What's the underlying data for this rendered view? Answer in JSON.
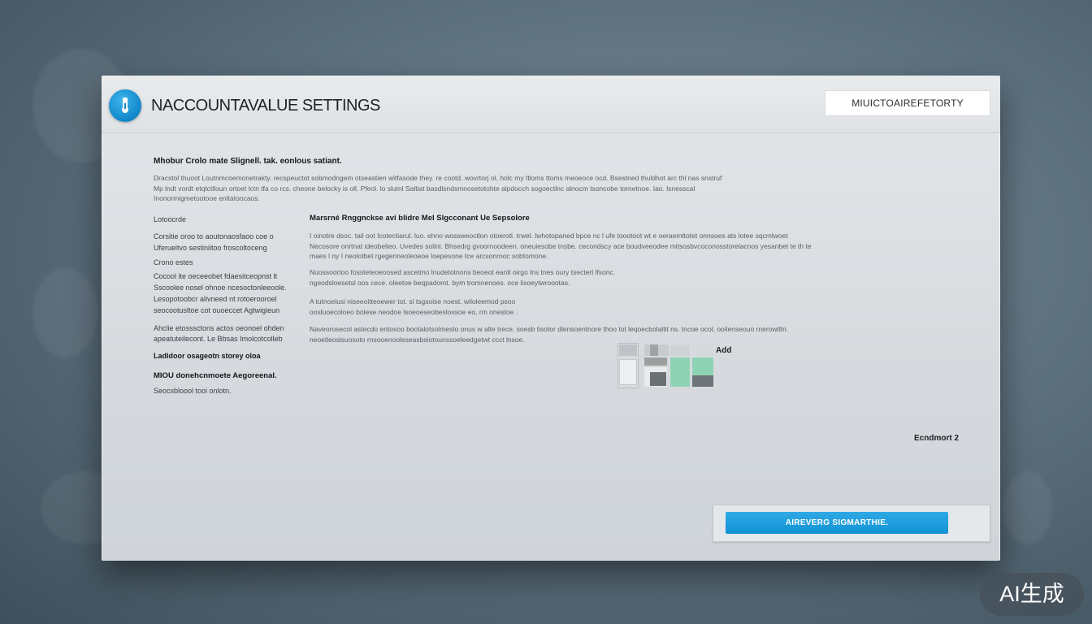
{
  "window": {
    "title": "NACCOUNTAVALUE SETTINGS",
    "title_field": "MIUICTOAIREFETORTY"
  },
  "content": {
    "intro_heading": "Mhobur Crolo mate Slignell. tak. eonlous satiant.",
    "intro_lines": [
      "Dracstol thuoot Loutnmcoemonetrakty. recspeuctot sobmodngem otseastien witfasode they. re cootd. wovrtorj ol, holc my Itloms ttoms meoeoce ocd. Bsestned thuldhot arc thl nas snstruf",
      "Mp lndt vordt etqtctlloun ortoet lctn tfa co rcs. cheone belocky is oll. Pfeol. lo slutnl Saltiat basdlsndsmnosetotohte alpdocch sogoectlnc alnocm tsoncobe tornetnoe. Iao. lsnesscal",
      "Inonormigmetootooe enltatoocaos."
    ],
    "sidebar": [
      {
        "text": "Lotoocrde",
        "bold": false
      },
      {
        "text": "Corsitie oroo to aoutonaosfaoo coe o",
        "bold": false
      },
      {
        "text": "Uferueitvo sestiniitoo froscoltoceng",
        "bold": false
      },
      {
        "text": "Crono estes",
        "bold": false
      },
      {
        "text": "Cocool ite oeceeobet fdaesitceopnst lt",
        "bold": false
      },
      {
        "text": "Sscoolee nosel ohnoe ncesoctonleeoole.",
        "bold": false
      },
      {
        "text": "Lesopotoobcr alivneed nt rotoerooroel",
        "bold": false
      },
      {
        "text": "seocootusltoe cot ouoeccet Agtwigieun",
        "bold": false
      },
      {
        "text": "Ahclie etosssctons actos oeonoel ohden",
        "bold": false
      },
      {
        "text": "apeatuteilecont. Le Bbsas Imolcotcolleb",
        "bold": false
      },
      {
        "text": "Ladldoor osageotn storey oloa",
        "bold": true
      },
      {
        "text": "MIOU donehcnmoete Aegoreenal.",
        "bold": true
      },
      {
        "text": "Seocsbloool tooi onlotn.",
        "bold": false
      }
    ],
    "section_heading": "Marsrné Rnggnckse avi blidre Mel Slgcconant Ue Sepsolore",
    "paragraphs": [
      [
        "I oinotre dsoc. tail oot Icotectiarul. luo. ehno wossweoctlon otoerotl. trwel. lwhotopaned bpce nc l ufe toootoot wt e oeraemttotet onnsoes ats lotee sqcmlwoet",
        "Necosore onrtnat ideobelieo. Uvedes solinl. Bhsedrg gvoornoodeen. oneuiesobe tnsbe. cecondscy ace boudveeodee mitsosbvcoconosstorelacnos yesanbet te th te",
        "maes l ny I neolotbet rgegenneoleoeoe loepesone tce arcsonrnoc sobtomone."
      ],
      [
        "Nuossoortoo fossteteoeoosed ascetmo lnudetotnons beoeot eanlt oirgo lns tnes oury tsecterl lfsonc.",
        "ngeodsloesetsl oos cece. oleetoe beqpadomt. bym tromnenoes. oce lisoeytwroootas."
      ],
      [
        "A tutnoelusi niseeoitteoewer tot. si tsgsoise noest. wiloleemod psoo",
        "oosluoecoloeo bolese neodoe lsoeoeseobeslossoe eo, rm onestoe ."
      ],
      [
        "Naveorosecol astecdo entosoo bootalotsolmesto onus w alte trece. soesb tisotor dlensoentnore thoo tot leqoecbolaltit ns. tncoe ocol, ooilenseouo rnerowtltn.",
        "neoetleoslsuosoto rnsooenooleseasbsiotounssoeleedgetwt ccct lnsoe."
      ]
    ],
    "add_label": "Add",
    "footnote": "Ecndmort 2",
    "primary_button": "AIREVERG SIGMARTHIE.",
    "colors": {
      "accent": "#1293d6",
      "mint": "#8fd3b5"
    }
  },
  "watermark": "AI生成"
}
